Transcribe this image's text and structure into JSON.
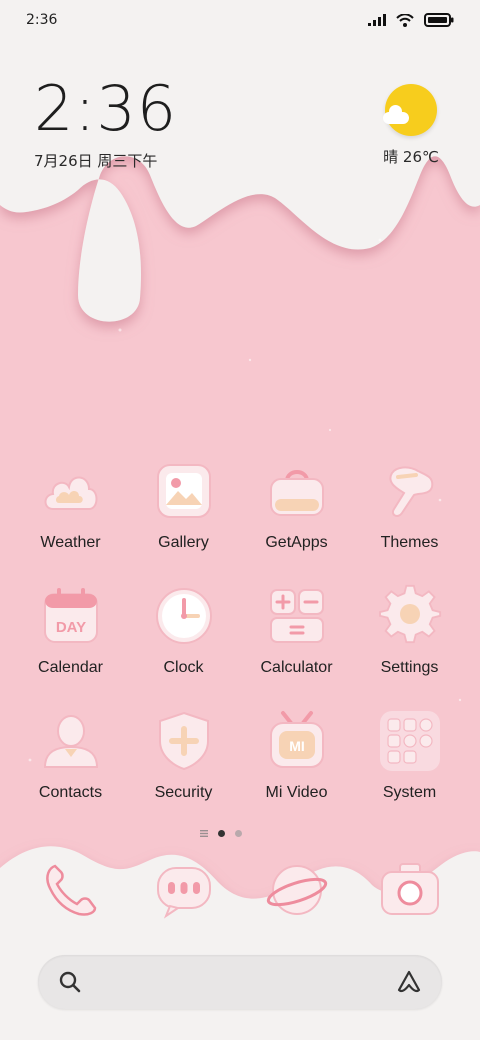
{
  "status_bar": {
    "time": "2:36",
    "icons": [
      "signal-icon",
      "wifi-icon",
      "battery-icon"
    ]
  },
  "clock_widget": {
    "time": "2:36",
    "date": "7月26日 周三下午"
  },
  "weather_widget": {
    "icon": "sun-cloud-icon",
    "condition_temp": "晴 26℃"
  },
  "apps": [
    {
      "label": "Weather",
      "icon": "weather-icon"
    },
    {
      "label": "Gallery",
      "icon": "gallery-icon"
    },
    {
      "label": "GetApps",
      "icon": "getapps-icon"
    },
    {
      "label": "Themes",
      "icon": "themes-icon"
    },
    {
      "label": "Calendar",
      "icon": "calendar-icon",
      "icon_text": "DAY"
    },
    {
      "label": "Clock",
      "icon": "clock-icon"
    },
    {
      "label": "Calculator",
      "icon": "calculator-icon"
    },
    {
      "label": "Settings",
      "icon": "settings-icon"
    },
    {
      "label": "Contacts",
      "icon": "contacts-icon"
    },
    {
      "label": "Security",
      "icon": "security-icon"
    },
    {
      "label": "Mi Video",
      "icon": "mi-video-icon",
      "icon_text": "MI"
    },
    {
      "label": "System",
      "icon": "system-folder-icon"
    }
  ],
  "page_indicator": {
    "pages": 2,
    "current": 1
  },
  "dock": [
    {
      "icon": "phone-icon"
    },
    {
      "icon": "messages-icon"
    },
    {
      "icon": "browser-icon"
    },
    {
      "icon": "camera-icon"
    }
  ],
  "search_bar": {
    "left_icon": "search-icon",
    "right_icon": "assistant-icon"
  },
  "colors": {
    "pink": "#f7c7cf",
    "cream": "#f4f2f1",
    "accent": "#ee8c9d",
    "sun": "#f7cd1d"
  }
}
